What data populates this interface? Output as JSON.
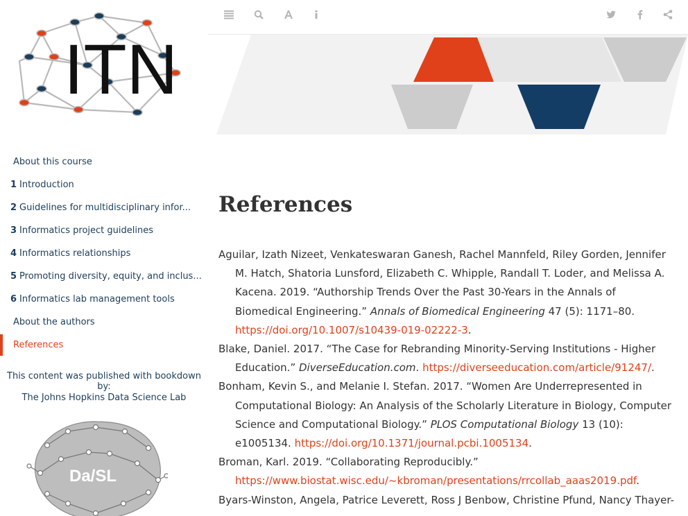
{
  "sidebar": {
    "logo_text": "ITN",
    "toc": [
      {
        "num": "",
        "label": "About this course"
      },
      {
        "num": "1",
        "label": "Introduction"
      },
      {
        "num": "2",
        "label": "Guidelines for multidisciplinary infor..."
      },
      {
        "num": "3",
        "label": "Informatics project guidelines"
      },
      {
        "num": "4",
        "label": "Informatics relationships"
      },
      {
        "num": "5",
        "label": "Promoting diversity, equity, and inclus..."
      },
      {
        "num": "6",
        "label": "Informatics lab management tools"
      },
      {
        "num": "",
        "label": "About the authors"
      },
      {
        "num": "",
        "label": "References"
      }
    ],
    "published_text": "This content was published with bookdown by:",
    "dsl_link": "The Johns Hopkins Data Science Lab",
    "dsl_logo_text": "Da/SL"
  },
  "toolbar": {
    "icons": [
      "toc-toggle-icon",
      "search-icon",
      "font-settings-icon",
      "info-icon",
      "twitter-icon",
      "facebook-icon",
      "share-icon"
    ]
  },
  "colors": {
    "accent": "#e0411a",
    "navy": "#143d66",
    "gray": "#cccccc",
    "nav_text": "#1c3d5a"
  },
  "main": {
    "title": "References",
    "references": [
      {
        "text": "Aguilar, Izath Nizeet, Venkateswaran Ganesh, Rachel Mannfeld, Riley Gorden, Jennifer M. Hatch, Shatoria Lunsford, Elizabeth C. Whipple, Randall T. Loder, and Melissa A. Kacena. 2019. “Authorship Trends Over the Past 30-Years in the Annals of Biomedical Engineering.” ",
        "journal": "Annals of Biomedical Engineering",
        "after": " 47 (5): 1171–80. ",
        "link": "https://doi.org/10.1007/s10439-019-02222-3",
        "end": "."
      },
      {
        "text": "Blake, Daniel. 2017. “The Case for Rebranding Minority-Serving Institutions - Higher Education.” ",
        "journal": "DiverseEducation.com",
        "after": ". ",
        "link": "https://diverseeducation.com/article/91247/",
        "end": "."
      },
      {
        "text": "Bonham, Kevin S., and Melanie I. Stefan. 2017. “Women Are Underrepresented in Computational Biology: An Analysis of the Scholarly Literature in Biology, Computer Science and Computational Biology.” ",
        "journal": "PLOS Computational Biology",
        "after": " 13 (10): e1005134. ",
        "link": "https://doi.org/10.1371/journal.pcbi.1005134",
        "end": "."
      },
      {
        "text": "Broman, Karl. 2019. “Collaborating Reproducibly.” ",
        "journal": "",
        "after": "",
        "link": "https://www.biostat.wisc.edu/~kbroman/presentations/rrcollab_aaas2019.pdf",
        "end": "."
      },
      {
        "text": "Byars-Winston, Angela, Patrice Leverett, Ross J Benbow, Christine Pfund, Nancy Thayer-",
        "journal": "",
        "after": "",
        "link": "",
        "end": ""
      }
    ]
  }
}
